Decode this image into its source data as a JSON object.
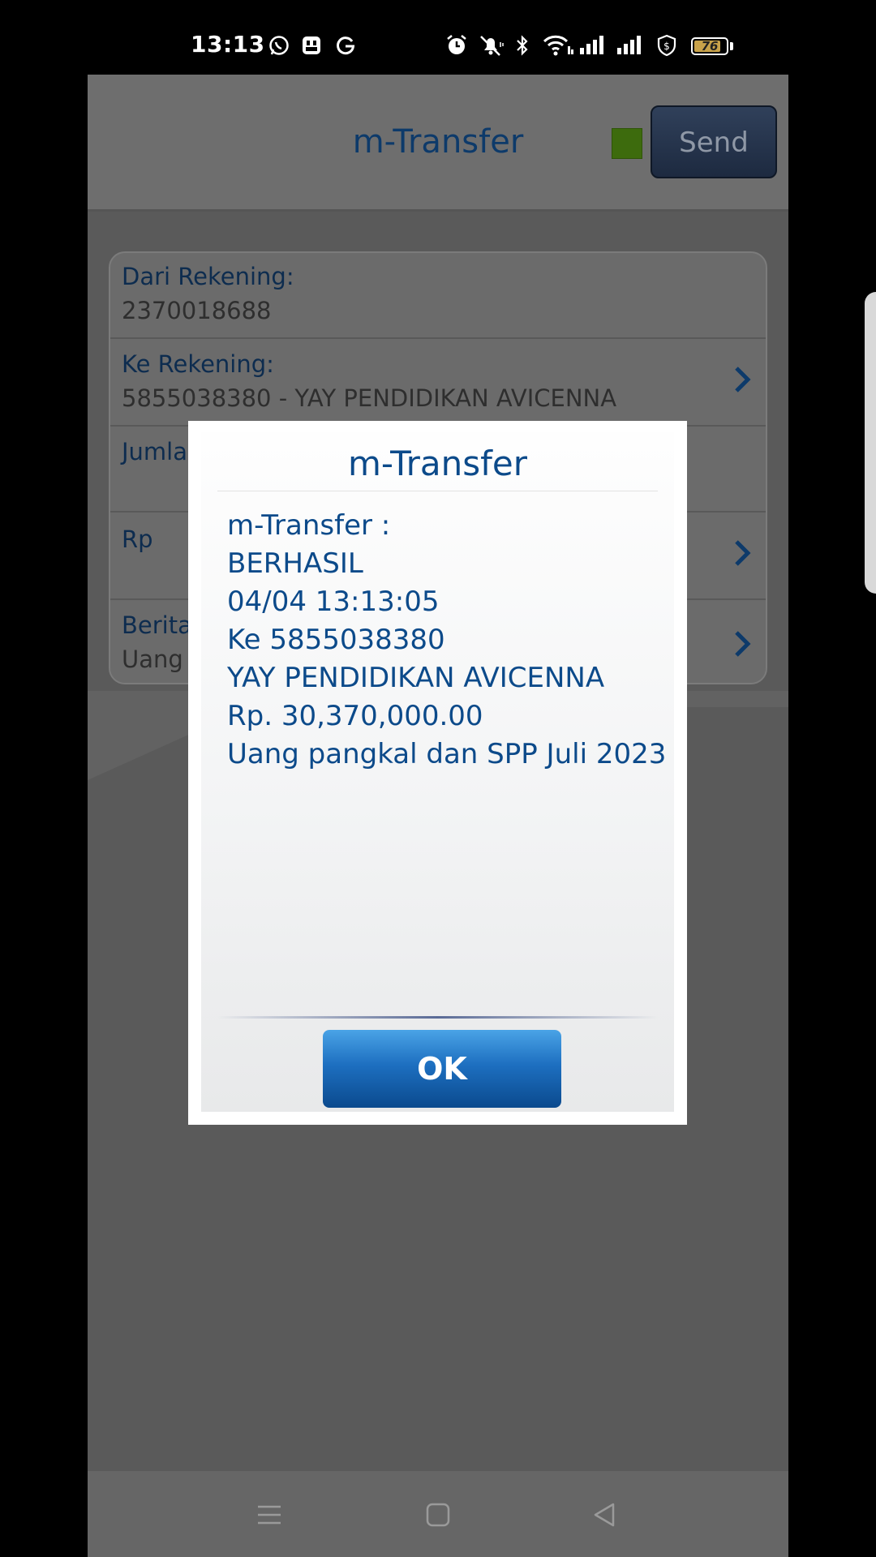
{
  "status_bar": {
    "time": "13:13",
    "battery_level": "76",
    "left_icons": [
      "whatsapp-icon",
      "album-icon",
      "google-icon"
    ],
    "right_icons": [
      "alarm-icon",
      "mute-icon",
      "bluetooth-icon",
      "wifi-icon",
      "signal-icon",
      "signal-icon",
      "vpn-shield-icon",
      "battery-icon"
    ]
  },
  "header": {
    "title": "m-Transfer",
    "send_label": "Send",
    "indicator_color": "#3d6b0d"
  },
  "form": {
    "rows": [
      {
        "label": "Dari Rekening:",
        "value": "2370018688"
      },
      {
        "label": "Ke Rekening:",
        "value": "5855038380 - YAY PENDIDIKAN AVICENNA"
      },
      {
        "label": "Jumla",
        "value": ""
      },
      {
        "label": "Rp",
        "value": ""
      },
      {
        "label": "Berita",
        "value": "Uang"
      }
    ]
  },
  "dialog": {
    "title": "m-Transfer",
    "lines": [
      "m-Transfer :",
      "BERHASIL",
      "04/04 13:13:05",
      "Ke 5855038380",
      "YAY PENDIDIKAN AVICENNA",
      "Rp. 30,370,000.00",
      "Uang pangkal dan SPP Juli 2023"
    ],
    "ok_label": "OK"
  },
  "nav": {
    "icons": [
      "menu-icon",
      "home-icon",
      "back-icon"
    ]
  },
  "colors": {
    "accent": "#0c4a8a",
    "ok_button": "#1d6fc0"
  }
}
